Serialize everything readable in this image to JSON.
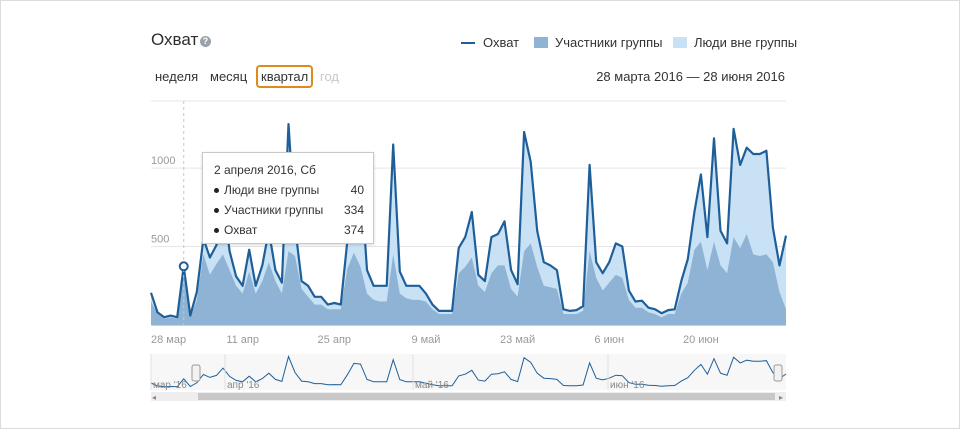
{
  "header": {
    "title": "Охват",
    "help_icon": "question-icon"
  },
  "periods": [
    "неделя",
    "месяц",
    "квартал",
    "год"
  ],
  "active_period": "квартал",
  "date_range": "28 марта 2016 — 28 июня 2016",
  "colors": {
    "line": "#1f5f99",
    "members": "#8fb3d4",
    "non_members": "#c9e1f4"
  },
  "chart_data": {
    "type": "area",
    "x_start": "2016-03-28",
    "x_end": "2016-06-28",
    "ylim": [
      0,
      1300
    ],
    "yticks": [
      500,
      1000
    ],
    "x_ticks": [
      "28 мар",
      "11 апр",
      "25 апр",
      "9 май",
      "23 май",
      "6 июн",
      "20 июн"
    ],
    "series": [
      {
        "name": "Охват",
        "kind": "line",
        "values": [
          205,
          80,
          50,
          60,
          50,
          374,
          60,
          210,
          550,
          430,
          510,
          810,
          470,
          310,
          250,
          480,
          250,
          380,
          600,
          350,
          270,
          1280,
          630,
          280,
          250,
          180,
          180,
          130,
          140,
          130,
          540,
          1000,
          970,
          350,
          250,
          250,
          250,
          1150,
          340,
          250,
          250,
          250,
          200,
          130,
          90,
          90,
          90,
          490,
          560,
          720,
          320,
          280,
          560,
          580,
          660,
          350,
          260,
          1230,
          1040,
          600,
          400,
          380,
          350,
          100,
          90,
          95,
          120,
          1020,
          400,
          330,
          400,
          520,
          500,
          220,
          150,
          155,
          110,
          100,
          75,
          95,
          100,
          280,
          420,
          720,
          960,
          560,
          1190,
          600,
          520,
          1250,
          1020,
          1130,
          1090,
          1090,
          1110,
          620,
          380,
          570
        ]
      },
      {
        "name": "Участники группы",
        "kind": "area",
        "values": [
          150,
          70,
          40,
          50,
          40,
          334,
          50,
          160,
          450,
          320,
          390,
          450,
          350,
          250,
          200,
          340,
          200,
          280,
          400,
          280,
          200,
          470,
          440,
          230,
          180,
          130,
          130,
          100,
          100,
          100,
          360,
          460,
          370,
          200,
          160,
          150,
          150,
          450,
          200,
          170,
          160,
          160,
          150,
          100,
          70,
          70,
          70,
          330,
          370,
          430,
          250,
          210,
          330,
          380,
          380,
          230,
          180,
          470,
          520,
          370,
          250,
          240,
          230,
          70,
          70,
          70,
          90,
          470,
          300,
          220,
          270,
          320,
          300,
          160,
          110,
          110,
          80,
          70,
          50,
          70,
          70,
          200,
          270,
          480,
          530,
          350,
          530,
          380,
          330,
          560,
          490,
          580,
          450,
          440,
          450,
          400,
          210,
          100
        ]
      },
      {
        "name": "Люди вне группы",
        "kind": "area",
        "values": [
          55,
          10,
          10,
          10,
          10,
          40,
          10,
          50,
          100,
          110,
          120,
          360,
          120,
          60,
          50,
          140,
          50,
          100,
          200,
          70,
          70,
          810,
          190,
          50,
          70,
          50,
          50,
          30,
          40,
          30,
          180,
          540,
          600,
          150,
          90,
          100,
          100,
          700,
          140,
          80,
          90,
          90,
          50,
          30,
          20,
          20,
          20,
          160,
          190,
          290,
          70,
          70,
          230,
          200,
          280,
          120,
          80,
          760,
          520,
          230,
          150,
          140,
          120,
          30,
          20,
          25,
          30,
          550,
          100,
          110,
          130,
          200,
          200,
          60,
          40,
          45,
          30,
          30,
          25,
          25,
          30,
          80,
          150,
          240,
          430,
          210,
          660,
          220,
          190,
          690,
          530,
          550,
          640,
          650,
          660,
          220,
          170,
          470
        ]
      }
    ],
    "tooltip": {
      "date": "2 апреля 2016, Сб",
      "rows": [
        {
          "label": "Люди вне группы",
          "value": "40"
        },
        {
          "label": "Участники группы",
          "value": "334"
        },
        {
          "label": "Охват",
          "value": "374"
        }
      ]
    },
    "navigator_labels": [
      "мар '16",
      "апр '16",
      "май '16",
      "июн '16"
    ]
  }
}
